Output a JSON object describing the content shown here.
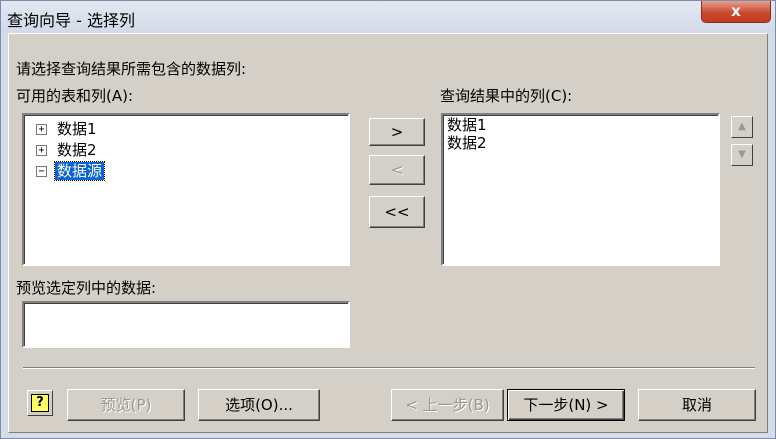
{
  "window": {
    "title": "查询向导 - 选择列",
    "close_label": "x"
  },
  "instruction": "请选择查询结果所需包含的数据列:",
  "available": {
    "label": "可用的表和列(A):",
    "items": [
      {
        "expander": "+",
        "label": "数据1",
        "selected": false
      },
      {
        "expander": "+",
        "label": "数据2",
        "selected": false
      },
      {
        "expander": "−",
        "label": "数据源",
        "selected": true
      }
    ]
  },
  "move_buttons": {
    "add": ">",
    "remove": "<",
    "remove_all": "<<"
  },
  "result": {
    "label": "查询结果中的列(C):",
    "items": [
      "数据1",
      "数据2"
    ]
  },
  "order_buttons": {
    "up_icon": "arrow-up-icon",
    "down_icon": "arrow-down-icon"
  },
  "preview": {
    "label": "预览选定列中的数据:",
    "value": ""
  },
  "footer": {
    "help_icon": "?",
    "preview_button": "预览(P)",
    "options_button": "选项(O)...",
    "back_button": "< 上一步(B)",
    "next_button": "下一步(N) >",
    "cancel_button": "取消"
  },
  "colors": {
    "selection": "#0a64d6",
    "face": "#d4d0c8",
    "close": "#c94a2f"
  }
}
